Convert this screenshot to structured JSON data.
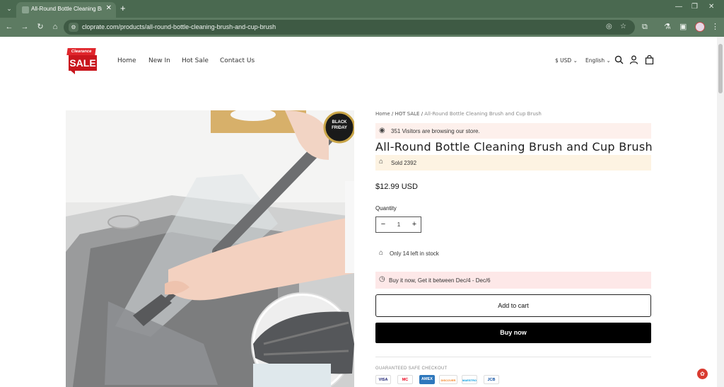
{
  "browser": {
    "tab_title": "All-Round Bottle Cleaning Brush and Cup Brush",
    "url": "cloprate.com/products/all-round-bottle-cleaning-brush-and-cup-brush",
    "new_tab": "+",
    "tab_close": "✕",
    "minimize": "—",
    "restore": "❐",
    "close": "✕"
  },
  "header": {
    "logo_top": "Clearance",
    "logo_main": "SALE",
    "nav": [
      "Home",
      "New In",
      "Hot Sale",
      "Contact Us"
    ],
    "currency": "$ USD",
    "language": "English"
  },
  "product": {
    "badge_line1": "BLACK",
    "badge_line2": "FRIDAY",
    "breadcrumb": {
      "home": "Home",
      "sep": "/",
      "cat": "HOT SALE",
      "current": "All-Round Bottle Cleaning Brush and Cup Brush"
    },
    "visitors": "351 Visitors are browsing our store.",
    "title": "All-Round Bottle Cleaning Brush and Cup Brush",
    "sold": "Sold 2392",
    "price": "$12.99 USD",
    "quantity_label": "Quantity",
    "quantity": "1",
    "stock": "Only 14 left in stock",
    "delivery": "Buy it now, Get it between Dec/4 - Dec/6",
    "add_to_cart": "Add to cart",
    "buy_now": "Buy now",
    "safe_checkout": "GUARANTEED SAFE CHECKOUT",
    "payments": [
      "VISA",
      "MC",
      "AMEX",
      "DISCOVER",
      "MAESTRO",
      "JCB"
    ]
  },
  "colors": {
    "chrome": "#5d7b62",
    "accent_red": "#c9161d",
    "visitors_bg": "#fdf0ec",
    "sold_bg": "#fdf3e2",
    "delivery_bg": "#fde8e8"
  }
}
